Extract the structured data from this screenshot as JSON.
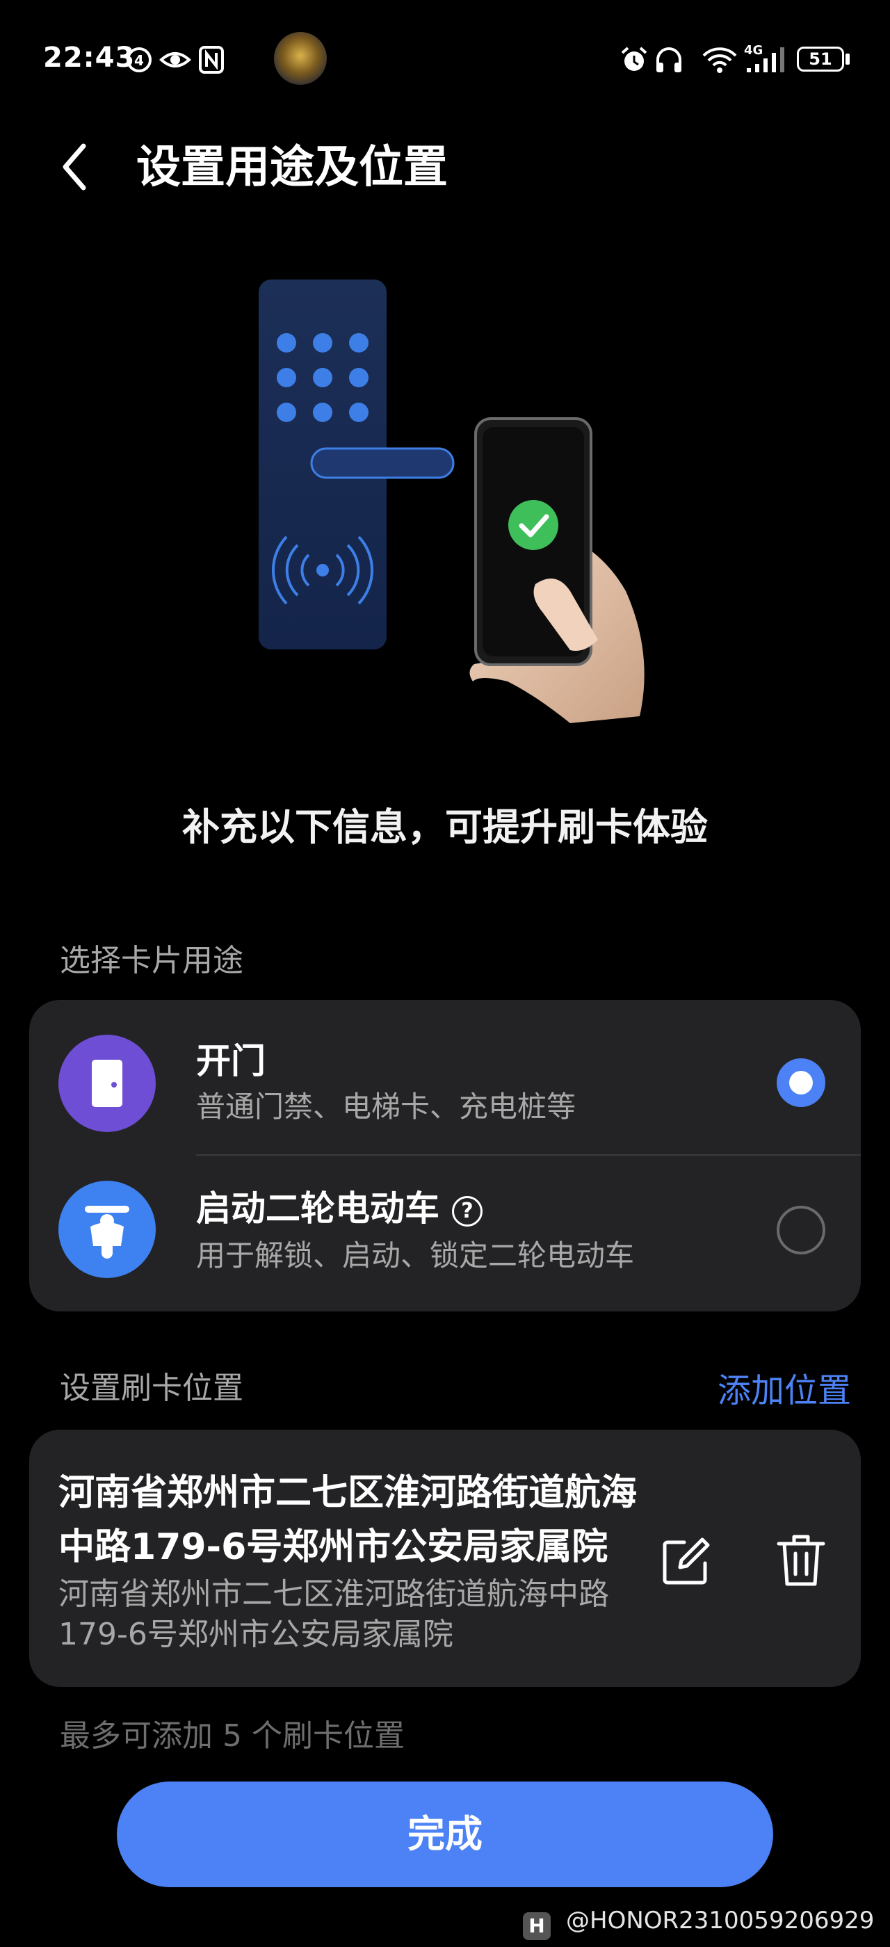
{
  "status_bar": {
    "time": "22:43",
    "battery": "51",
    "network": "4G",
    "left_icons": [
      "data-saver-icon",
      "eye-comfort-icon",
      "nfc-icon"
    ],
    "right_icons": [
      "alarm-icon",
      "headphones-icon",
      "wifi-icon",
      "signal-icon",
      "battery-icon"
    ]
  },
  "header": {
    "title": "设置用途及位置",
    "back_icon": "back-arrow-icon"
  },
  "promo_text": "补充以下信息，可提升刷卡体验",
  "usage": {
    "label": "选择卡片用途",
    "options": [
      {
        "title": "开门",
        "subtitle": "普通门禁、电梯卡、充电桩等",
        "icon": "door-icon",
        "icon_color": "#6e4ed4",
        "selected": true
      },
      {
        "title": "启动二轮电动车",
        "subtitle": "用于解锁、启动、锁定二轮电动车",
        "icon": "scooter-icon",
        "icon_color": "#3d82f0",
        "selected": false,
        "help": "?"
      }
    ]
  },
  "location": {
    "label": "设置刷卡位置",
    "add_label": "添加位置",
    "items": [
      {
        "title": "河南省郑州市二七区淮河路街道航海中路179-6号郑州市公安局家属院",
        "subtitle": "河南省郑州市二七区淮河路街道航海中路179-6号郑州市公安局家属院"
      }
    ],
    "hint": "最多可添加 5 个刷卡位置"
  },
  "done_button": "完成",
  "watermark": "@HONOR2310059206929",
  "colors": {
    "accent": "#4c82f5",
    "card_bg": "#232325",
    "background": "#000000",
    "success": "#3fbf5a"
  }
}
